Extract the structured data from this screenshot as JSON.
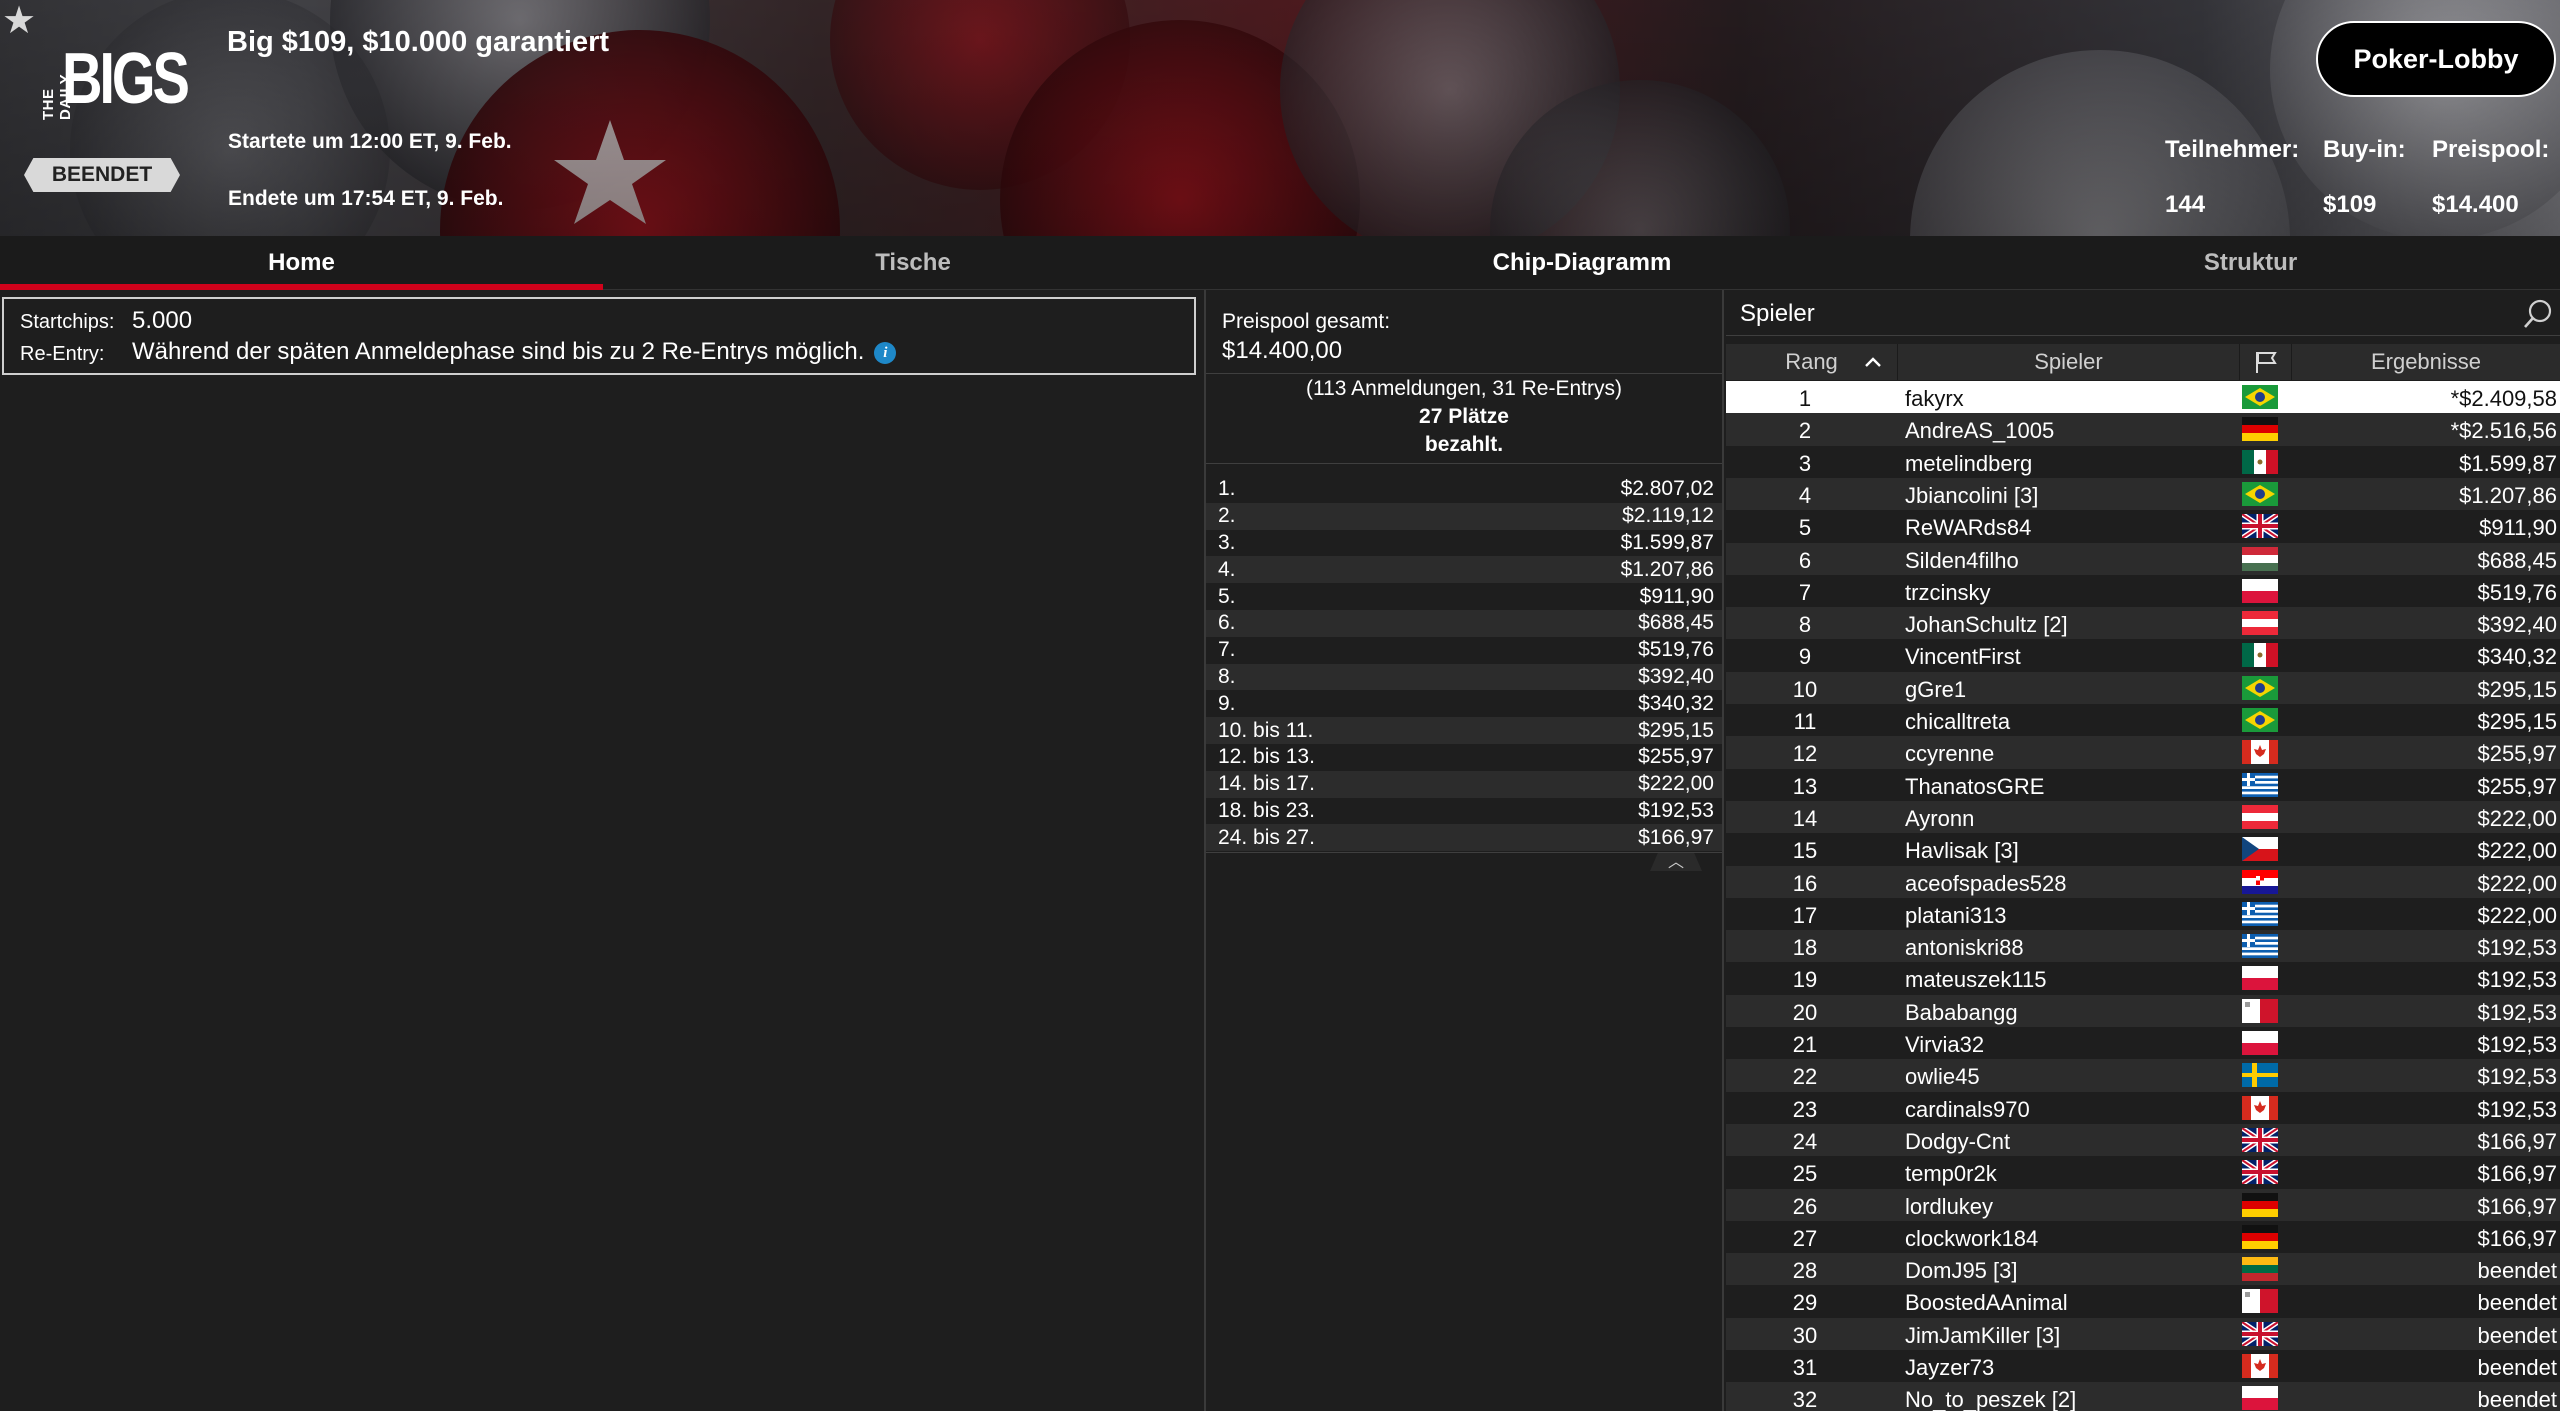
{
  "header": {
    "title": "Big $109, $10.000 garantiert",
    "started": "Startete um 12:00 ET, 9. Feb.",
    "ended": "Endete um 17:54 ET, 9. Feb.",
    "status": "BEENDET",
    "logo": {
      "small": "THE DAILY",
      "big": "BIGS"
    },
    "lobby_button": "Poker-Lobby",
    "stats": {
      "participants_label": "Teilnehmer:",
      "participants": "144",
      "buyin_label": "Buy-in:",
      "buyin": "$109",
      "prizepool_label": "Preispool:",
      "prizepool": "$14.400"
    },
    "favorite_icon": "star-icon"
  },
  "tabs": [
    "Home",
    "Tische",
    "Chip-Diagramm",
    "Struktur"
  ],
  "info": {
    "startchips_label": "Startchips:",
    "startchips": "5.000",
    "reentry_label": "Re-Entry:",
    "reentry": "Während der späten Anmeldephase sind bis zu 2 Re-Entrys möglich.",
    "info_icon": "i"
  },
  "prize": {
    "pool_label": "Preispool gesamt:",
    "pool_value": "$14.400,00",
    "summary_line1": "(113 Anmeldungen, 31 Re-Entrys)",
    "summary_line2": "27 Plätze",
    "summary_line3": "bezahlt.",
    "payouts": [
      {
        "place": "1.",
        "amount": "$2.807,02"
      },
      {
        "place": "2.",
        "amount": "$2.119,12"
      },
      {
        "place": "3.",
        "amount": "$1.599,87"
      },
      {
        "place": "4.",
        "amount": "$1.207,86"
      },
      {
        "place": "5.",
        "amount": "$911,90"
      },
      {
        "place": "6.",
        "amount": "$688,45"
      },
      {
        "place": "7.",
        "amount": "$519,76"
      },
      {
        "place": "8.",
        "amount": "$392,40"
      },
      {
        "place": "9.",
        "amount": "$340,32"
      },
      {
        "place": "10. bis 11.",
        "amount": "$295,15"
      },
      {
        "place": "12. bis 13.",
        "amount": "$255,97"
      },
      {
        "place": "14. bis 17.",
        "amount": "$222,00"
      },
      {
        "place": "18. bis 23.",
        "amount": "$192,53"
      },
      {
        "place": "24. bis 27.",
        "amount": "$166,97"
      }
    ]
  },
  "players": {
    "search_label": "Spieler",
    "columns": {
      "rank": "Rang",
      "player": "Spieler",
      "results": "Ergebnisse"
    },
    "rows": [
      {
        "rank": "1",
        "name": "fakyrx",
        "flag": "br",
        "result": "*$2.409,58"
      },
      {
        "rank": "2",
        "name": "AndreAS_1005",
        "flag": "de",
        "result": "*$2.516,56"
      },
      {
        "rank": "3",
        "name": "metelindberg",
        "flag": "mx",
        "result": "$1.599,87"
      },
      {
        "rank": "4",
        "name": "Jbiancolini [3]",
        "flag": "br",
        "result": "$1.207,86"
      },
      {
        "rank": "5",
        "name": "ReWARds84",
        "flag": "gb",
        "result": "$911,90"
      },
      {
        "rank": "6",
        "name": "Silden4filho",
        "flag": "hu",
        "result": "$688,45"
      },
      {
        "rank": "7",
        "name": "trzcinsky",
        "flag": "pl",
        "result": "$519,76"
      },
      {
        "rank": "8",
        "name": "JohanSchultz [2]",
        "flag": "at",
        "result": "$392,40"
      },
      {
        "rank": "9",
        "name": "VincentFirst",
        "flag": "mx",
        "result": "$340,32"
      },
      {
        "rank": "10",
        "name": "gGre1",
        "flag": "br",
        "result": "$295,15"
      },
      {
        "rank": "11",
        "name": "chicalltreta",
        "flag": "br",
        "result": "$295,15"
      },
      {
        "rank": "12",
        "name": "ccyrenne",
        "flag": "ca",
        "result": "$255,97"
      },
      {
        "rank": "13",
        "name": "ThanatosGRE",
        "flag": "gr",
        "result": "$255,97"
      },
      {
        "rank": "14",
        "name": "Ayronn",
        "flag": "at",
        "result": "$222,00"
      },
      {
        "rank": "15",
        "name": "Havlisak [3]",
        "flag": "cz",
        "result": "$222,00"
      },
      {
        "rank": "16",
        "name": "aceofspades528",
        "flag": "hr",
        "result": "$222,00"
      },
      {
        "rank": "17",
        "name": "platani313",
        "flag": "gr",
        "result": "$222,00"
      },
      {
        "rank": "18",
        "name": "antoniskri88",
        "flag": "gr",
        "result": "$192,53"
      },
      {
        "rank": "19",
        "name": "mateuszek115",
        "flag": "pl",
        "result": "$192,53"
      },
      {
        "rank": "20",
        "name": "Bababangg",
        "flag": "mt",
        "result": "$192,53"
      },
      {
        "rank": "21",
        "name": "Virvia32",
        "flag": "pl",
        "result": "$192,53"
      },
      {
        "rank": "22",
        "name": "owlie45",
        "flag": "se",
        "result": "$192,53"
      },
      {
        "rank": "23",
        "name": "cardinals970",
        "flag": "ca",
        "result": "$192,53"
      },
      {
        "rank": "24",
        "name": "Dodgy-Cnt",
        "flag": "gb",
        "result": "$166,97"
      },
      {
        "rank": "25",
        "name": "temp0r2k",
        "flag": "gb",
        "result": "$166,97"
      },
      {
        "rank": "26",
        "name": "lordlukey",
        "flag": "de",
        "result": "$166,97"
      },
      {
        "rank": "27",
        "name": "clockwork184",
        "flag": "de",
        "result": "$166,97"
      },
      {
        "rank": "28",
        "name": "DomJ95 [3]",
        "flag": "lt",
        "result": "beendet"
      },
      {
        "rank": "29",
        "name": "BoostedAAnimal",
        "flag": "mt",
        "result": "beendet"
      },
      {
        "rank": "30",
        "name": "JimJamKiller [3]",
        "flag": "gb",
        "result": "beendet"
      },
      {
        "rank": "31",
        "name": "Jayzer73",
        "flag": "ca",
        "result": "beendet"
      },
      {
        "rank": "32",
        "name": "No_to_peszek [2]",
        "flag": "pl",
        "result": "beendet"
      }
    ]
  },
  "colors": {
    "accent": "#d0021b",
    "info": "#1e88c8",
    "bg": "#1e1e1e"
  }
}
